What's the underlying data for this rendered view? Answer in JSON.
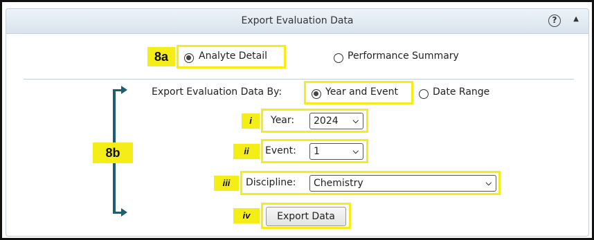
{
  "panel": {
    "title": "Export Evaluation Data",
    "help_icon": "?",
    "collapse_icon": "▲"
  },
  "annotations": {
    "tag_8a": "8a",
    "tag_8b": "8b",
    "tag_i": "i",
    "tag_ii": "ii",
    "tag_iii": "iii",
    "tag_iv": "iv",
    "highlight_color": "#f5ed16",
    "bracket_color": "#1f5e6e"
  },
  "report_type": {
    "options": [
      {
        "label": "Analyte Detail",
        "selected": true
      },
      {
        "label": "Performance Summary",
        "selected": false
      }
    ]
  },
  "export_by": {
    "label": "Export Evaluation Data By:",
    "options": [
      {
        "label": "Year and Event",
        "selected": true
      },
      {
        "label": "Date Range",
        "selected": false
      }
    ]
  },
  "fields": {
    "year_label": "Year:",
    "year_value": "2024",
    "event_label": "Event:",
    "event_value": "1",
    "discipline_label": "Discipline:",
    "discipline_value": "Chemistry"
  },
  "actions": {
    "export_label": "Export Data"
  }
}
